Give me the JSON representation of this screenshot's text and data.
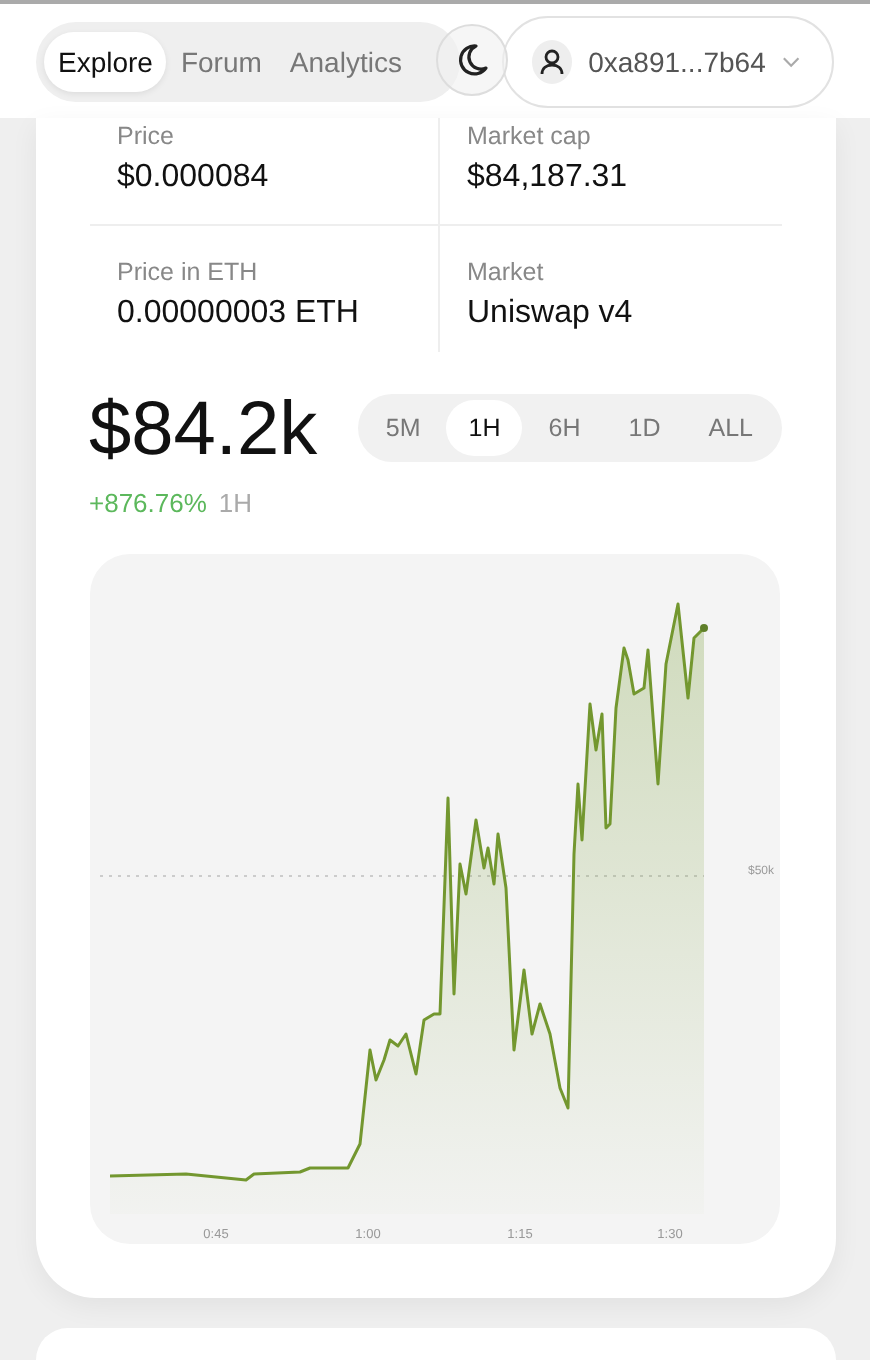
{
  "nav": {
    "tabs": [
      {
        "label": "Explore",
        "selected": true
      },
      {
        "label": "Forum",
        "selected": false
      },
      {
        "label": "Analytics",
        "selected": false
      }
    ]
  },
  "wallet": {
    "address": "0xa891...7b64"
  },
  "stats": [
    {
      "label": "Price",
      "value": "$0.000084"
    },
    {
      "label": "Market cap",
      "value": "$84,187.31"
    },
    {
      "label": "Price in ETH",
      "value": "0.00000003 ETH"
    },
    {
      "label": "Market",
      "value": "Uniswap v4"
    }
  ],
  "price": {
    "value": "$84.2k",
    "change": "+876.76%",
    "period": "1H"
  },
  "ranges": [
    {
      "label": "5M",
      "selected": false
    },
    {
      "label": "1H",
      "selected": true
    },
    {
      "label": "6H",
      "selected": false
    },
    {
      "label": "1D",
      "selected": false
    },
    {
      "label": "ALL",
      "selected": false
    }
  ],
  "chart": {
    "y_label": "$50k",
    "x_labels": [
      "0:45",
      "1:00",
      "1:15",
      "1:30"
    ]
  }
}
